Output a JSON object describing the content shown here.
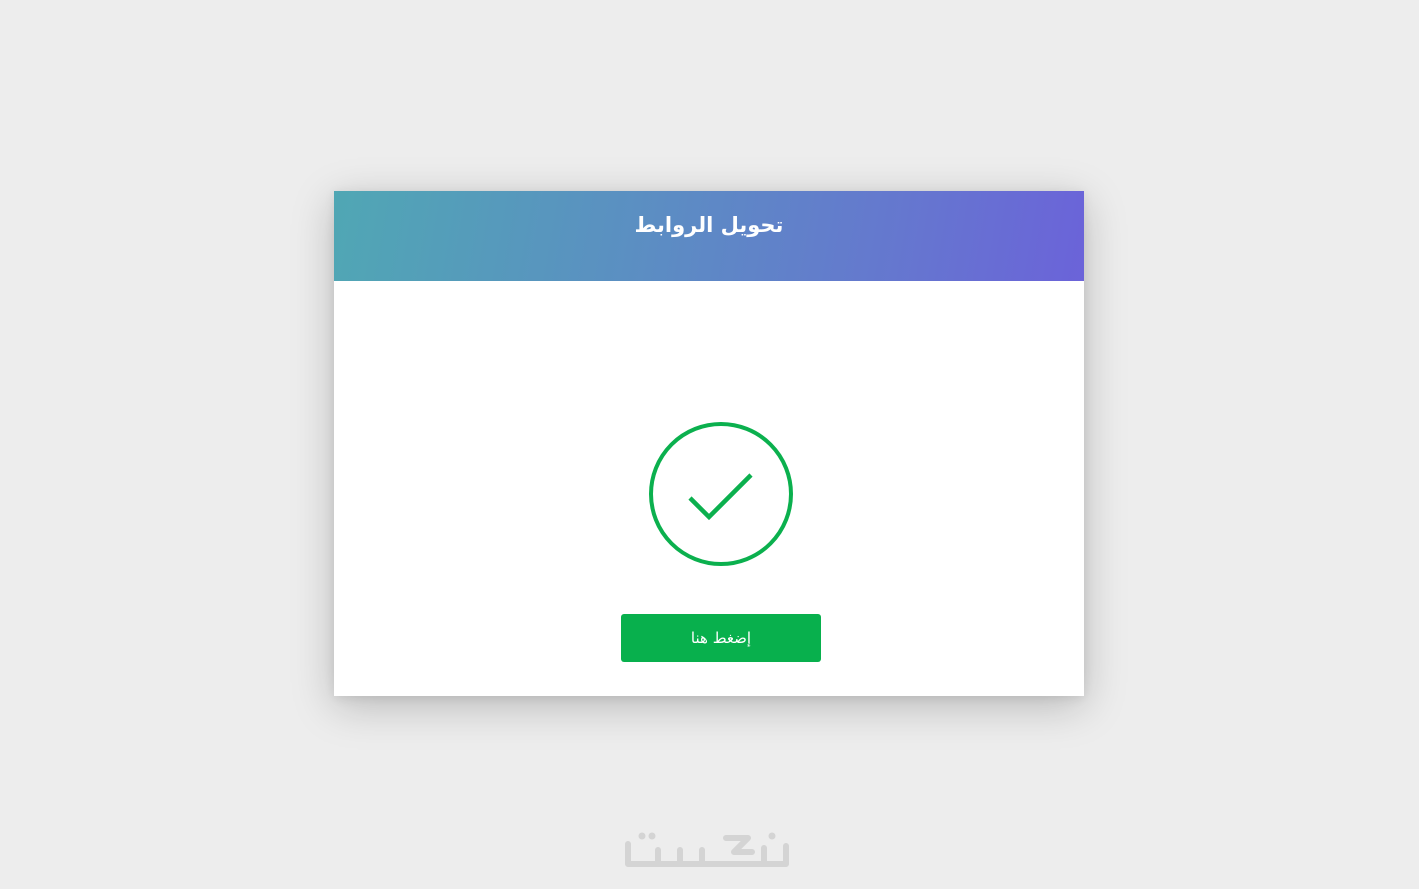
{
  "card": {
    "title": "تحويل الروابط",
    "button_label": "إضغط هنا",
    "status_icon": "check-circle-icon"
  },
  "watermark": {
    "text": "خمسات"
  },
  "colors": {
    "background": "#ededed",
    "header_gradient_start": "#50a7b4",
    "header_gradient_end": "#6b63d9",
    "success_green": "#08b04d",
    "watermark": "#d6d6d6"
  }
}
